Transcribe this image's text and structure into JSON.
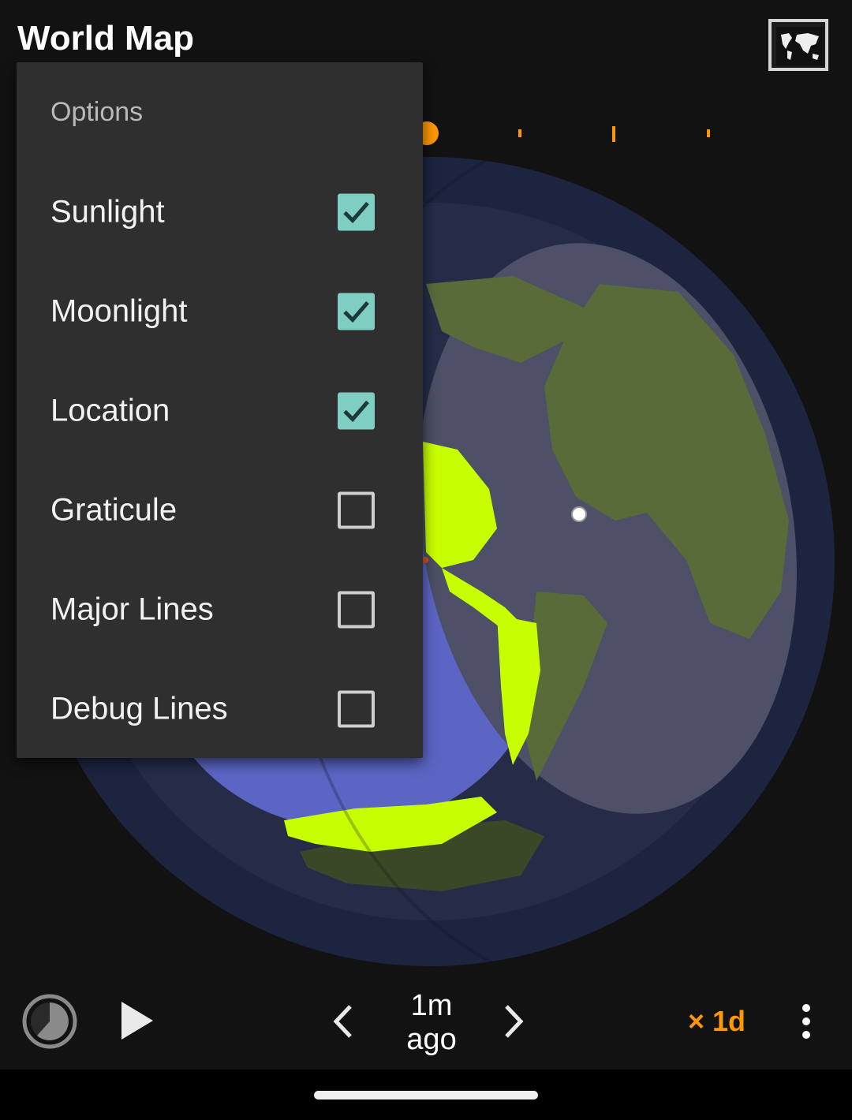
{
  "app": {
    "title": "World Map",
    "map_mode_icon": "world-map-icon"
  },
  "options_menu": {
    "header": "Options",
    "items": [
      {
        "label": "Sunlight",
        "checked": true
      },
      {
        "label": "Moonlight",
        "checked": true
      },
      {
        "label": "Location",
        "checked": true
      },
      {
        "label": "Graticule",
        "checked": false
      },
      {
        "label": "Major Lines",
        "checked": false
      },
      {
        "label": "Debug Lines",
        "checked": false
      }
    ]
  },
  "controls": {
    "time_line1": "1m",
    "time_line2": "ago",
    "speed": "× 1d",
    "icons": [
      "clock-icon",
      "play-icon",
      "chevron-left-icon",
      "chevron-right-icon",
      "more-vert-icon"
    ]
  },
  "colors": {
    "accent": "#ff9800",
    "checkbox": "#7ecec3",
    "menu_bg": "#2f2f2f",
    "ocean_lit": "#5b66c4",
    "land_lit": "#c8ff00",
    "land_dark": "#5a6b3a"
  }
}
